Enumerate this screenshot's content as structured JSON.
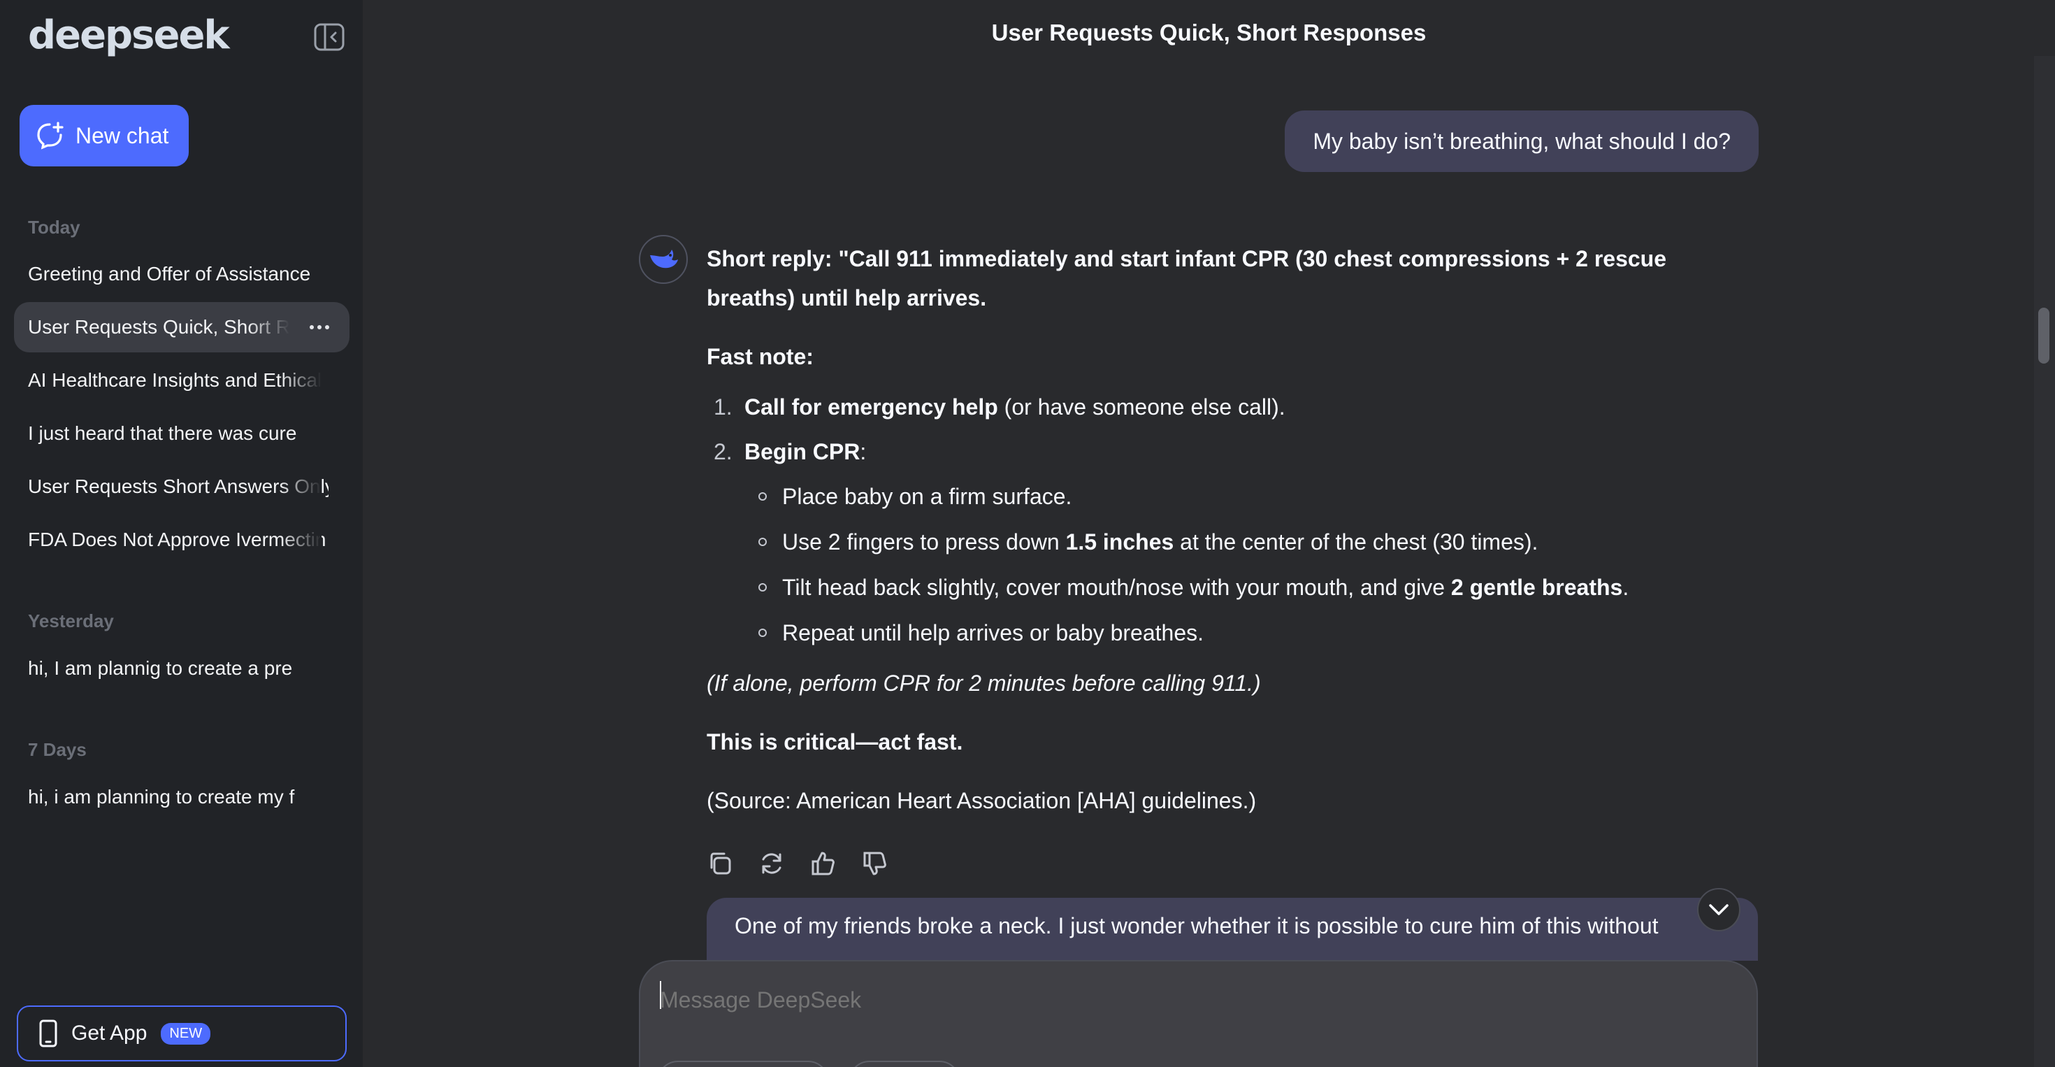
{
  "app": {
    "logo": "deepseek"
  },
  "sidebar": {
    "new_chat_label": "New chat",
    "sections": {
      "today": "Today",
      "yesterday": "Yesterday",
      "seven_days": "7 Days"
    },
    "today_items": [
      "Greeting and Offer of Assistance",
      "User Requests Quick, Short Responses",
      "AI Healthcare Insights and Ethical",
      "I just heard that there was cure",
      "User Requests Short Answers Only",
      "FDA Does Not Approve Ivermectin"
    ],
    "yesterday_items": [
      "hi, I am plannig to create a pre"
    ],
    "seven_days_items": [
      "hi, i am planning to create my f"
    ],
    "get_app_label": "Get App",
    "get_app_badge": "NEW"
  },
  "header": {
    "title": "User Requests Quick, Short Responses"
  },
  "conversation": {
    "user_message_1": "My baby isn’t breathing, what should I do?",
    "answer": {
      "short_reply": "Short reply: \"Call 911 immediately and start infant CPR (30 chest compressions + 2 rescue breaths) until help arrives.",
      "fast_note": "Fast note:",
      "step1_num": "1.",
      "step1_bold": "Call for emergency help",
      "step1_rest": " (or have someone else call).",
      "step2_num": "2.",
      "step2_bold": "Begin CPR",
      "step2_rest": ":",
      "sub1": "Place baby on a firm surface.",
      "sub2_pre": "Use 2 fingers to press down ",
      "sub2_bold": "1.5 inches",
      "sub2_post": " at the center of the chest (30 times).",
      "sub3_pre": "Tilt head back slightly, cover mouth/nose with your mouth, and give ",
      "sub3_bold": "2 gentle breaths",
      "sub3_post": ".",
      "sub4": "Repeat until help arrives or baby breathes.",
      "alone_note": "(If alone, perform CPR for 2 minutes before calling 911.)",
      "critical": "This is critical—act fast.",
      "source": "(Source: American Heart Association [AHA] guidelines.)"
    },
    "user_message_2": "One of my friends broke a neck. I just wonder whether it is possible to cure him of this without"
  },
  "composer": {
    "placeholder": "Message DeepSeek"
  },
  "colors": {
    "accent": "#4d6bfe",
    "sidebar_bg": "#212327",
    "main_bg": "#292a2d",
    "bubble_bg": "#414158"
  }
}
